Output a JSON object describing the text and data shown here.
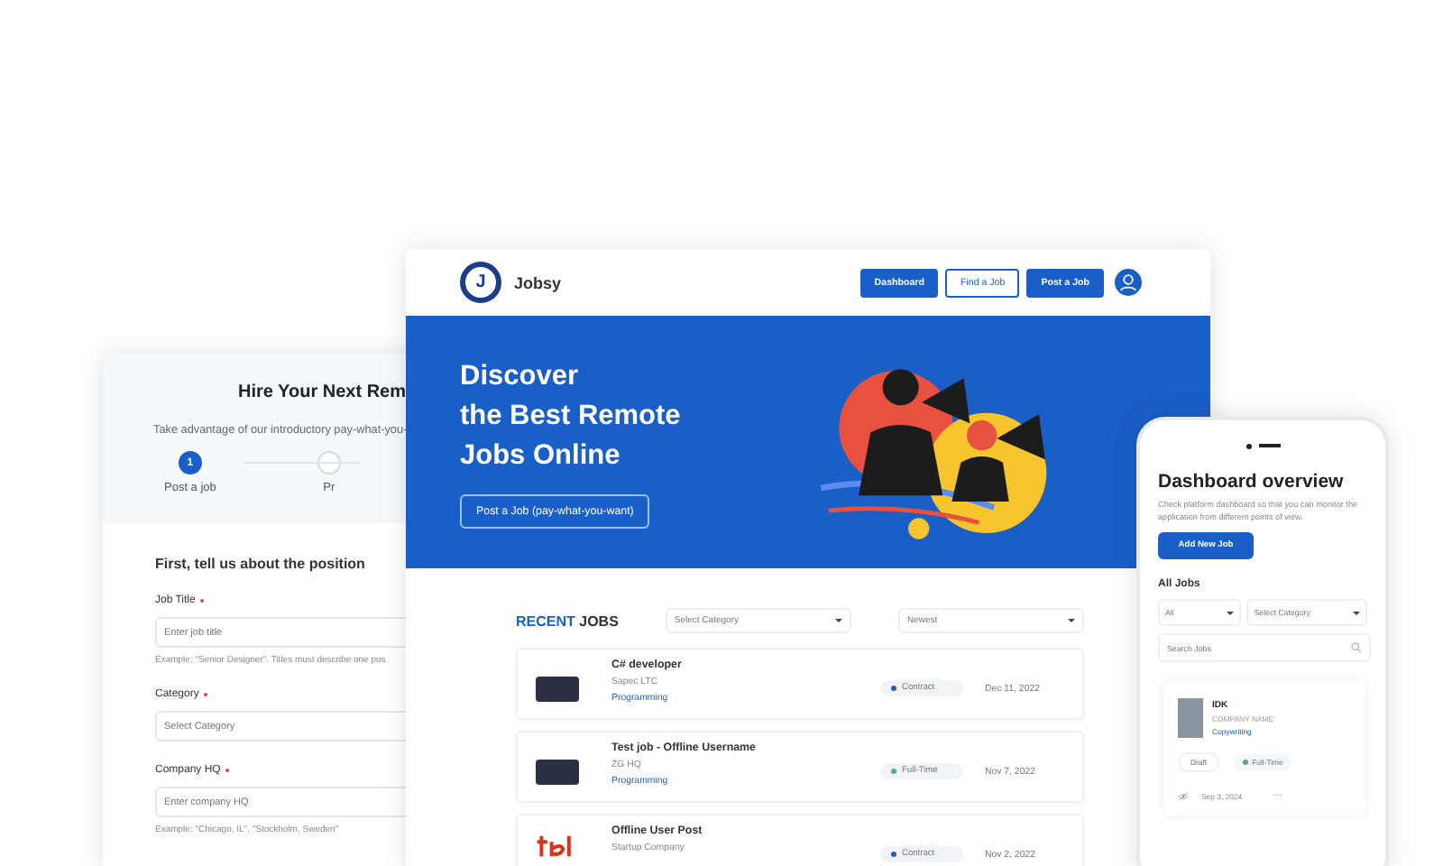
{
  "post_form": {
    "title": "Hire Your Next Rem",
    "intro": "Take advantage of our introductory pay-what-you-",
    "steps": [
      {
        "number": "1",
        "label": "Post a job",
        "selected": true
      },
      {
        "label": "Pr",
        "selected": false
      }
    ],
    "section_title": "First, tell us about the position",
    "fields": [
      {
        "label": "Job Title",
        "required": true,
        "placeholder": "Enter job title",
        "hint": "Example: \"Senior Designer\".  Titles must describe one pos"
      },
      {
        "label": "Category",
        "required": true,
        "placeholder": "Select Category"
      },
      {
        "label": "Company HQ",
        "required": true,
        "placeholder": "Enter company HQ",
        "hint": "Example: \"Chicago, IL\",  \"Stockholm, Sweden\""
      }
    ]
  },
  "site": {
    "brand": "Jobsy",
    "logo_letter": "J",
    "nav": [
      {
        "label": "Dashboard",
        "kind": "filled"
      },
      {
        "label": "Find a Job",
        "kind": "outline"
      },
      {
        "label": "Post a Job",
        "kind": "filled"
      }
    ],
    "hero": {
      "title_lines": [
        "Discover",
        "the Best Remote",
        "Jobs Online"
      ],
      "button": "Post a Job (pay-what-you-want)"
    },
    "recent": {
      "accent": "RECENT",
      "rest": "JOBS",
      "filters": [
        "Select Category",
        "Newest"
      ]
    },
    "jobs": [
      {
        "kind": "photo",
        "title": "C# developer",
        "company": "Sapec LTC",
        "category": "Programming",
        "type": "Contract",
        "color": "#2f55c0",
        "date": "Dec 11, 2022"
      },
      {
        "kind": "photo",
        "title": "Test job - Offline Username",
        "company": "ZG HQ",
        "category": "Programming",
        "type": "Full-Time",
        "color": "#4cb07c",
        "date": "Nov 7, 2022"
      },
      {
        "kind": "logo",
        "title": "Offline User Post",
        "company": "Startup Company",
        "type": "Contract",
        "color": "#2f55c0",
        "date": "Nov 2, 2022"
      }
    ]
  },
  "dashboard": {
    "title": "Dashboard overview",
    "description": "Check platform dashboard so that you can monitor the application from different points of view.",
    "button": "Add New Job",
    "section": "All Jobs",
    "filters": [
      "All",
      "Select Category"
    ],
    "search_placeholder": "Search Jobs",
    "card": {
      "title": "IDK",
      "company": "COMPANY NAME",
      "category": "Copywriting",
      "status": "Draft",
      "type": "Full-Time",
      "color": "#4cb07c",
      "date": "Sep 3, 2024",
      "more": "···"
    }
  }
}
